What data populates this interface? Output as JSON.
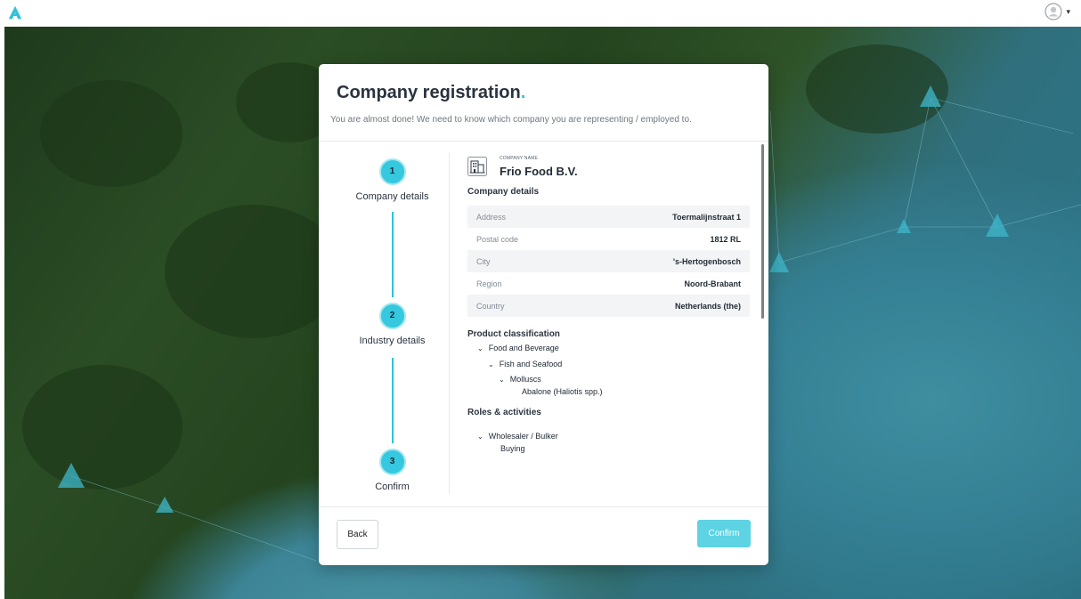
{
  "colors": {
    "accent": "#35c8de",
    "accent_light": "#5dd3e3",
    "text_dark": "#2a3340",
    "brand_logo": "#2ec3d8"
  },
  "header": {
    "logo_icon": "brand-logo-icon",
    "user_icon": "user-avatar-icon",
    "user_caret": "▾"
  },
  "modal": {
    "title": "Company registration",
    "title_dot": ".",
    "subtitle": "You are almost done!  We need to know which company you are representing / employed to."
  },
  "steps": [
    {
      "number": "1",
      "label": "Company details"
    },
    {
      "number": "2",
      "label": "Industry details"
    },
    {
      "number": "3",
      "label": "Confirm"
    }
  ],
  "company": {
    "name_label": "COMPANY NAME",
    "name": "Frio Food B.V.",
    "details_title": "Company details",
    "details": [
      {
        "key": "Address",
        "value": "Toermalijnstraat 1"
      },
      {
        "key": "Postal code",
        "value": "1812 RL"
      },
      {
        "key": "City",
        "value": "'s-Hertogenbosch"
      },
      {
        "key": "Region",
        "value": "Noord-Brabant"
      },
      {
        "key": "Country",
        "value": "Netherlands (the)"
      }
    ]
  },
  "product_classification": {
    "title": "Product classification",
    "levels": [
      "Food and Beverage",
      "Fish and Seafood",
      "Molluscs",
      "Abalone (Haliotis spp.)"
    ]
  },
  "roles": {
    "title": "Roles & activities",
    "role": "Wholesaler / Bulker",
    "activity": "Buying"
  },
  "footer": {
    "back_label": "Back",
    "confirm_label": "Confirm"
  }
}
